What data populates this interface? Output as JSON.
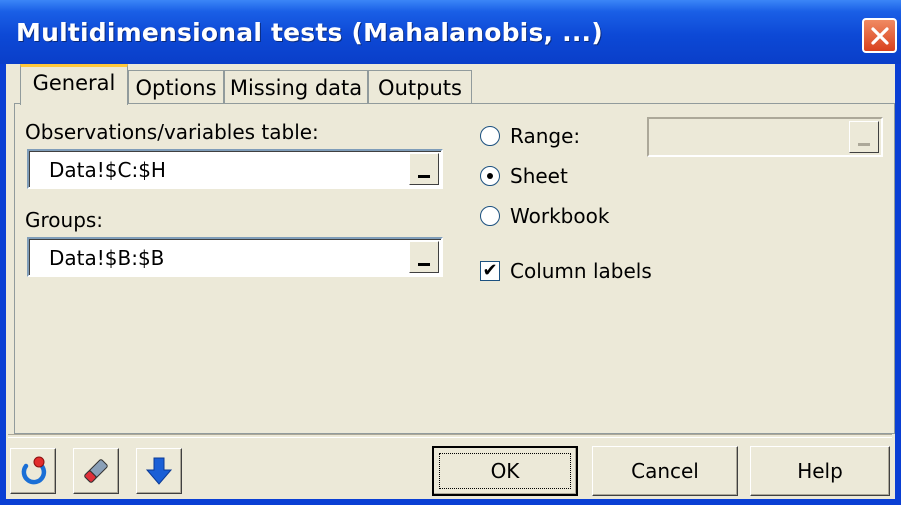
{
  "window": {
    "title": "Multidimensional tests (Mahalanobis, ...)"
  },
  "tabs": [
    {
      "label": "General",
      "active": true
    },
    {
      "label": "Options",
      "active": false
    },
    {
      "label": "Missing data",
      "active": false
    },
    {
      "label": "Outputs",
      "active": false
    }
  ],
  "general": {
    "observations_label": "Observations/variables table:",
    "observations_value": "Data!$C:$H",
    "groups_label": "Groups:",
    "groups_value": "Data!$B:$B",
    "output": {
      "range_label": "Range:",
      "range_value": "",
      "sheet_label": "Sheet",
      "workbook_label": "Workbook",
      "selected": "Sheet"
    },
    "column_labels": {
      "label": "Column labels",
      "checked": true
    }
  },
  "buttons": {
    "ok": "OK",
    "cancel": "Cancel",
    "help": "Help"
  },
  "icons": {
    "reset": "reset-icon",
    "clear": "eraser-icon",
    "down": "down-arrow-icon",
    "close": "close-icon"
  },
  "colors": {
    "titlebar": "#0a3ec9",
    "close": "#d9411e",
    "accent": "#1a6fd6"
  }
}
